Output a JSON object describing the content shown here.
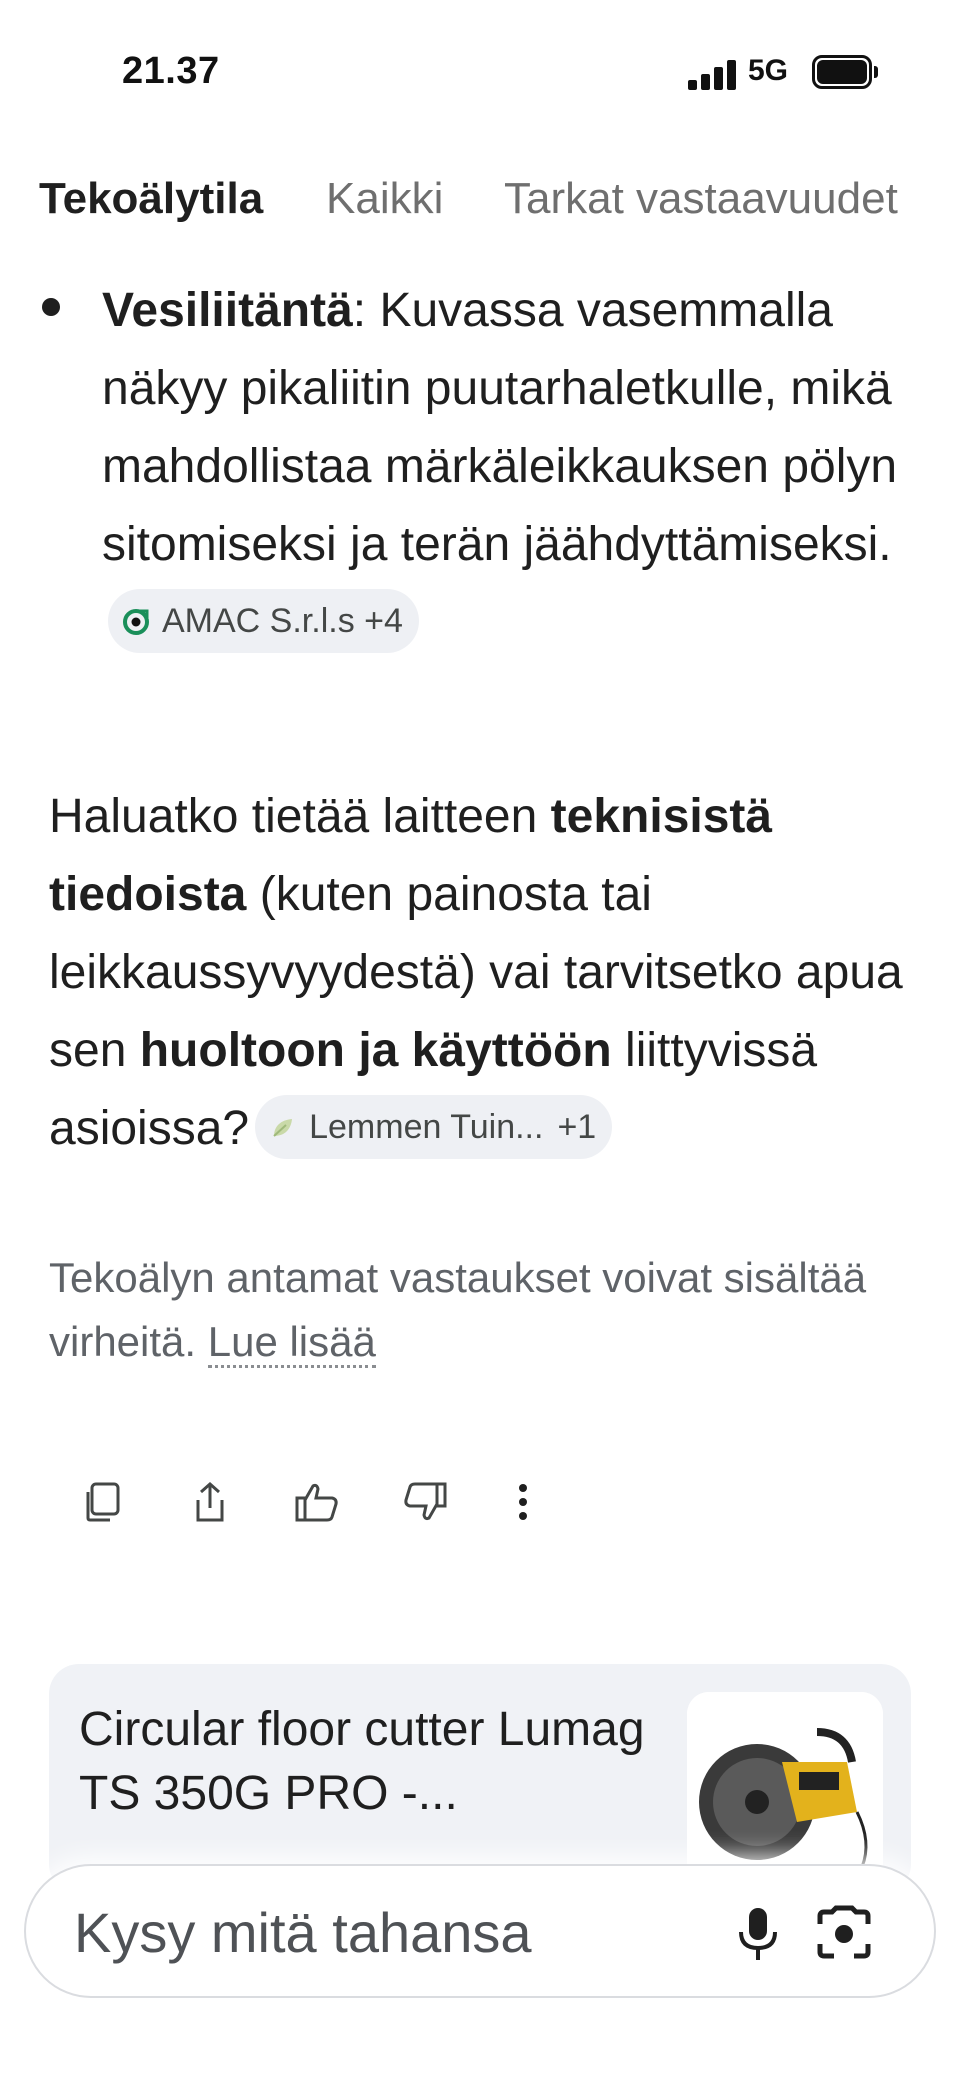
{
  "status_bar": {
    "time": "21.37",
    "network": "5G"
  },
  "tabs": [
    {
      "label": "Tekoälytila",
      "active": true
    },
    {
      "label": "Kaikki",
      "active": false
    },
    {
      "label": "Tarkat vastaavuudet",
      "active": false
    }
  ],
  "answer": {
    "bullet": {
      "term": "Vesiliitäntä",
      "text": ": Kuvassa vasemmalla näkyy pikaliitin puutarhaletkulle, mikä mahdollistaa märkäleikkauksen pölyn sitomiseksi ja terän jäähdyttämiseksi.",
      "chip": {
        "label": "AMAC S.r.l.s +4",
        "icon": "source-icon"
      }
    },
    "question": {
      "part1": "Haluatko tietää laitteen ",
      "bold1": "teknisistä tiedoista",
      "part2": " (kuten painosta tai leikkaussyvyydestä) vai tarvitsetko apua sen ",
      "bold2": "huoltoon ja käyttöön",
      "part3": " liittyvissä asioissa?",
      "chip": {
        "label": "Lemmen Tuin...",
        "count": "+1",
        "icon": "leaf-icon"
      }
    }
  },
  "disclaimer": {
    "text": "Tekoälyn antamat vastaukset voivat sisältää virheitä. ",
    "link": "Lue lisää"
  },
  "actions": [
    "copy-icon",
    "share-icon",
    "thumbs-up-icon",
    "thumbs-down-icon",
    "more-icon"
  ],
  "result_card": {
    "title": "Circular floor cutter Lumag TS 350G PRO -..."
  },
  "search": {
    "placeholder": "Kysy mitä tahansa"
  },
  "colors": {
    "chip_bg": "#eef0f4",
    "card_bg": "#f0f2f6",
    "muted_text": "#5f6368",
    "accent_green": "#1a8f5a"
  }
}
